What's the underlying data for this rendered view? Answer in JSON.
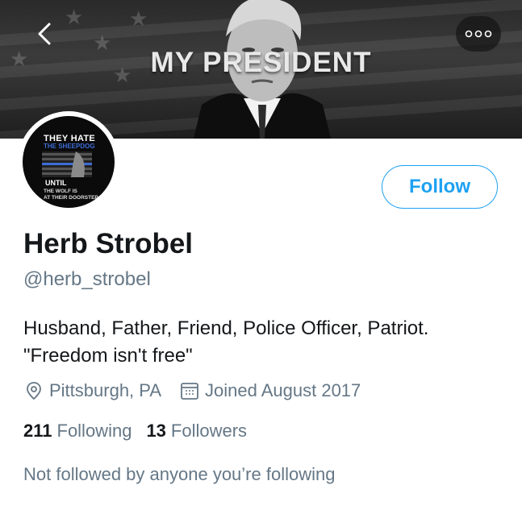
{
  "banner": {
    "title": "MY PRESIDENT"
  },
  "avatar": {
    "line1": "THEY HATE",
    "line2": "THE SHEEPDOG",
    "line3": "UNTIL",
    "line4": "THE WOLF IS",
    "line5": "AT THEIR DOORSTEP"
  },
  "actions": {
    "follow_label": "Follow"
  },
  "profile": {
    "name": "Herb Strobel",
    "handle": "@herb_strobel",
    "bio_line1": "Husband, Father, Friend, Police Officer, Patriot.",
    "bio_line2": "\"Freedom isn't free\"",
    "location": "Pittsburgh, PA",
    "joined": "Joined August 2017"
  },
  "stats": {
    "following_count": "211",
    "following_label": "Following",
    "followers_count": "13",
    "followers_label": "Followers"
  },
  "social_context": "Not followed by anyone you’re following",
  "colors": {
    "accent": "#1da1f2",
    "secondary_text": "#657786",
    "primary_text": "#14171a"
  }
}
